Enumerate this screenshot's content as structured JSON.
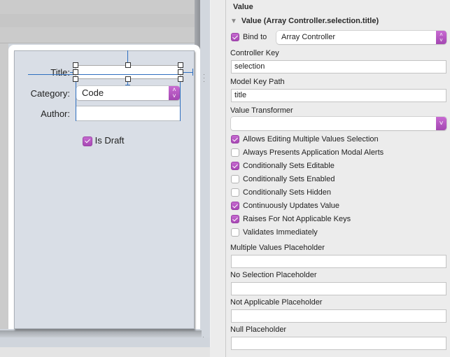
{
  "canvas": {
    "form": {
      "title_label": "Title:",
      "title_value": "",
      "category_label": "Category:",
      "category_value": "Code",
      "author_label": "Author:",
      "author_value": "",
      "is_draft_label": "Is Draft",
      "is_draft_checked": true
    }
  },
  "inspector": {
    "section_title": "Value",
    "binding_title": "Value (Array Controller.selection.title)",
    "bind_to": {
      "label": "Bind to",
      "checked": true,
      "value": "Array Controller"
    },
    "controller_key": {
      "label": "Controller Key",
      "value": "selection"
    },
    "model_key_path": {
      "label": "Model Key Path",
      "value": "title"
    },
    "value_transformer": {
      "label": "Value Transformer",
      "value": ""
    },
    "options": [
      {
        "label": "Allows Editing Multiple Values Selection",
        "checked": true
      },
      {
        "label": "Always Presents Application Modal Alerts",
        "checked": false
      },
      {
        "label": "Conditionally Sets Editable",
        "checked": true
      },
      {
        "label": "Conditionally Sets Enabled",
        "checked": false
      },
      {
        "label": "Conditionally Sets Hidden",
        "checked": false
      },
      {
        "label": "Continuously Updates Value",
        "checked": true
      },
      {
        "label": "Raises For Not Applicable Keys",
        "checked": true
      },
      {
        "label": "Validates Immediately",
        "checked": false
      }
    ],
    "placeholders": [
      {
        "label": "Multiple Values Placeholder",
        "value": ""
      },
      {
        "label": "No Selection Placeholder",
        "value": ""
      },
      {
        "label": "Not Applicable Placeholder",
        "value": ""
      },
      {
        "label": "Null Placeholder",
        "value": ""
      }
    ],
    "accent_color": "#b456c0"
  }
}
